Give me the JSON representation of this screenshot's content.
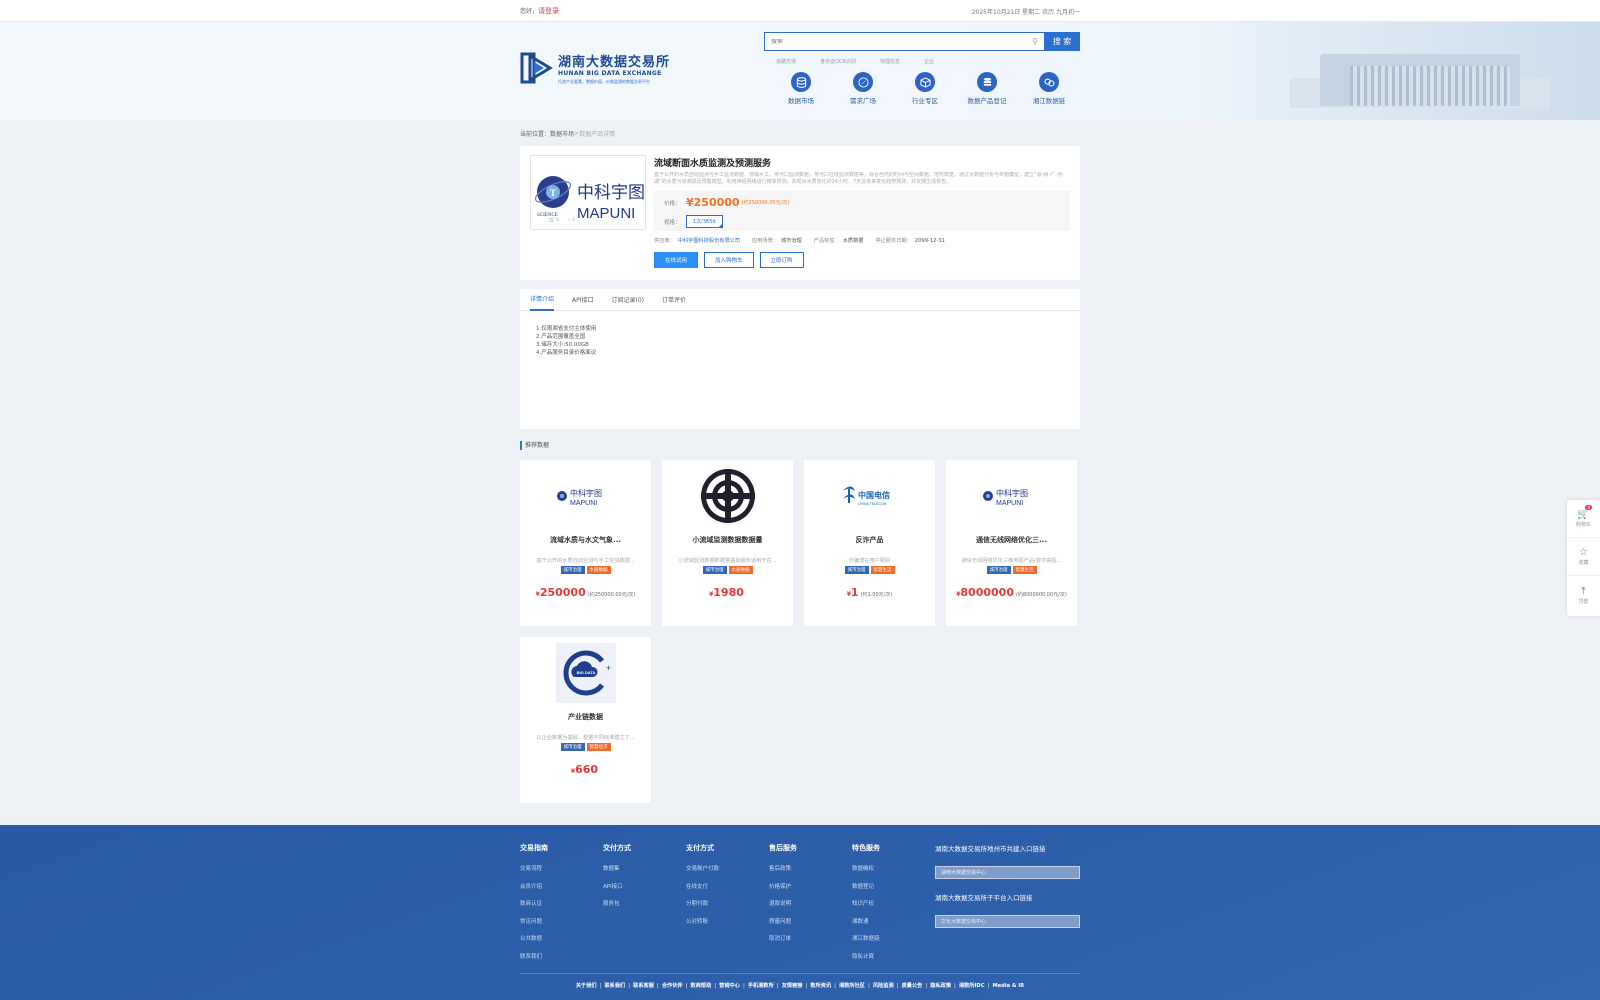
{
  "topbar": {
    "greeting": "您好，",
    "login": "请登录",
    "date": "2025年10月21日 星期二 农历 九月初一"
  },
  "logo": {
    "cn": "湖南大数据交易所",
    "en": "HUNAN BIG DATA EXCHANGE",
    "slogan": "打造产业要素、数据价值、价格监测的数据交易平台"
  },
  "search": {
    "placeholder": "搜索",
    "button": "搜 索",
    "hotwords": [
      "道路交通",
      "身份证OCR识别",
      "地理信息",
      "企业"
    ]
  },
  "nav": [
    {
      "label": "数据市场",
      "icon": "database-icon"
    },
    {
      "label": "需求广场",
      "icon": "compass-icon"
    },
    {
      "label": "行业专区",
      "icon": "cube-icon"
    },
    {
      "label": "数据产品登记",
      "icon": "register-icon"
    },
    {
      "label": "湘江数据链",
      "icon": "chain-icon"
    }
  ],
  "breadcrumb": {
    "prefix": "当前位置：",
    "parent": "数据市场",
    "sep": " > ",
    "current": "数据产品详情"
  },
  "product": {
    "title": "流域断面水质监测及预测服务",
    "logo_cn": "中科宇图",
    "logo_en": "MAPUNI",
    "logo_small": "SCIENCE",
    "desc": "基于公开的水质自动监测与手工监测数据、流域水文、排污口监测数据，排污口在线监测数据等，综合自然的时间与空间数据、地形数据，通过大数据分析与专题模型，建立“源-网-厂-河-湖”的水质污染溯源及预警模型，利用神经网络进行精准预测，实现对水质变化的24小时、7天及未来变化趋势预测，并定期生成报告。",
    "price_label": "价格：",
    "price": "¥250000",
    "price_note": "(约250000.00元/次)",
    "spec_label": "规格：",
    "spec": "1次/365d",
    "provider_label": "供应商：",
    "provider": "中科宇图科技股份有限公司",
    "scene_label": "应用场景：",
    "scene": "城市治理",
    "tag_label": "产品标签：",
    "tag": "水质数据",
    "date_label": "停止服务日期：",
    "date": "2099-12-31",
    "btn_buy": "在线试用",
    "btn_cart": "加入购物车",
    "btn_fav": "立即订购",
    "cart_count": "0",
    "fav_count": "0"
  },
  "tabs": [
    "详情介绍",
    "API接口",
    "订阅记录(0)",
    "订单评价"
  ],
  "details": [
    "1.仅限湘省支付主体使用",
    "2.产品范围覆盖全国",
    "3.储存大小:50.00GB",
    "4.产品服务目录价格面议"
  ],
  "recommend": {
    "title": "推荐数据",
    "items": [
      {
        "name": "流域水质与水文气象...",
        "desc": "基于公开的水质自动监测与手工监测数据...",
        "tag1": "城市治理",
        "tag2": "水质数据",
        "yen": "¥",
        "price": "250000",
        "note": "(约250000.00元/次)"
      },
      {
        "name": "小流域监测数据数据量",
        "desc": "小流域监测数据数据量基础服务适用于在...",
        "tag1": "城市治理",
        "tag2": "水质数据",
        "yen": "¥",
        "price": "1980",
        "note": ""
      },
      {
        "name": "反诈产品",
        "desc": "诈骗潜在用户甄别",
        "tag1": "城市治理",
        "tag2": "智慧生活",
        "yen": "¥",
        "price": "1",
        "note": "(约1.00元/次)"
      },
      {
        "name": "通信无线网络优化三...",
        "desc": "通信无线网络优化三维地图产品(数字高程...",
        "tag1": "城市治理",
        "tag2": "智慧生活",
        "yen": "¥",
        "price": "8000000",
        "note": "(约8000000.00元/次)"
      },
      {
        "name": "产业链数据",
        "desc": "以企业数据为基础，根据不同标准建立了...",
        "tag1": "城市治理",
        "tag2": "智慧经济",
        "yen": "¥",
        "price": "660",
        "note": ""
      }
    ]
  },
  "footer": {
    "cols": [
      {
        "h": "交易指南",
        "items": [
          "交易流程",
          "会员介绍",
          "数商认证",
          "常见问题",
          "公共数据",
          "联系我们"
        ]
      },
      {
        "h": "交付方式",
        "items": [
          "数据集",
          "API接口",
          "服务包"
        ]
      },
      {
        "h": "支付方式",
        "items": [
          "交易账户付款",
          "在线支付",
          "分期付款",
          "公对转账"
        ]
      },
      {
        "h": "售后服务",
        "items": [
          "售后政策",
          "价格保护",
          "退款说明",
          "质量问题",
          "取消订单"
        ]
      },
      {
        "h": "特色服务",
        "items": [
          "数据确权",
          "数据登记",
          "知识产权",
          "湘数通",
          "湘江数据链",
          "隐私计算"
        ]
      }
    ],
    "right1": "湖南大数据交易所地州市共建入口链接",
    "sel1": "湖南大数据交易中心",
    "right2": "湖南大数据交易所子平台入口链接",
    "sel2": "文化大数据交易中心",
    "links": [
      "关于我们",
      "联系我们",
      "联系客服",
      "合作伙伴",
      "数商帮助",
      "营销中心",
      "手机湘数所",
      "友情链接",
      "数所资讯",
      "湘数所社区",
      "风险监测",
      "质量公告",
      "隐私政策",
      "湘数所IDC",
      "Media & IR"
    ]
  },
  "side": {
    "cart": "购物车",
    "cart_badge": "0",
    "fav": "收藏",
    "top": "顶部"
  }
}
